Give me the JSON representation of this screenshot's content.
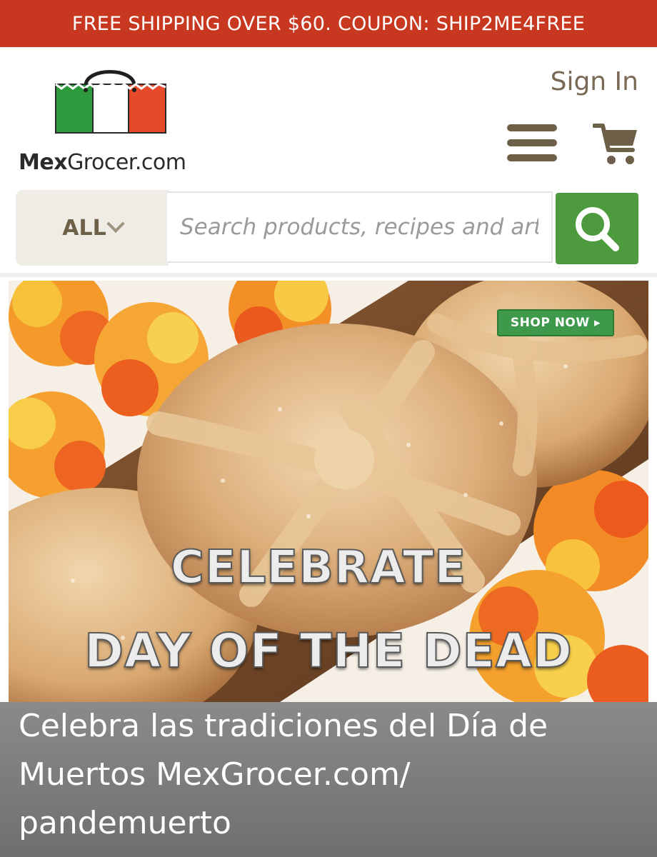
{
  "promo": {
    "text": "FREE SHIPPING OVER $60. COUPON: SHIP2ME4FREE"
  },
  "header": {
    "logo_bold": "Mex",
    "logo_rest": "Grocer.com",
    "sign_in_label": "Sign In",
    "menu_icon": "hamburger-menu-icon",
    "cart_icon": "shopping-cart-icon"
  },
  "search": {
    "category_label": "ALL",
    "placeholder": "Search products, recipes and arti",
    "button_icon": "magnifier-icon"
  },
  "hero": {
    "shop_now_label": "SHOP NOW ▸",
    "headline_line1": "CELEBRATE",
    "headline_line2": "DAY OF THE DEAD"
  },
  "caption": {
    "line1": "Celebra las tradiciones del Día de",
    "line2": "Muertos MexGrocer.com/",
    "line3": "pandemuerto"
  },
  "colors": {
    "promo_bg": "#c8371f",
    "search_button": "#4e9a3f",
    "flag_green": "#2e9a3e",
    "flag_red": "#e64a2a",
    "accent_brown": "#6e6048"
  }
}
